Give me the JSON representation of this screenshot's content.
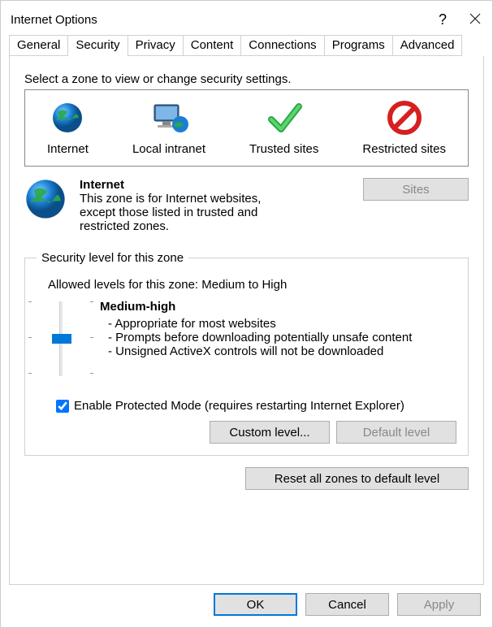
{
  "title": "Internet Options",
  "tabs": [
    "General",
    "Security",
    "Privacy",
    "Content",
    "Connections",
    "Programs",
    "Advanced"
  ],
  "zone_prompt": "Select a zone to view or change security settings.",
  "zones": [
    "Internet",
    "Local intranet",
    "Trusted sites",
    "Restricted sites"
  ],
  "zone_detail": {
    "title": "Internet",
    "desc": "This zone is for Internet websites, except those listed in trusted and restricted zones."
  },
  "sites_button": "Sites",
  "security_legend": "Security level for this zone",
  "allowed_levels": "Allowed levels for this zone: Medium to High",
  "level": {
    "name": "Medium-high",
    "b1": "- Appropriate for most websites",
    "b2": "- Prompts before downloading potentially unsafe content",
    "b3": "- Unsigned ActiveX controls will not be downloaded"
  },
  "protected_mode": "Enable Protected Mode (requires restarting Internet Explorer)",
  "custom_level": "Custom level...",
  "default_level": "Default level",
  "reset_all": "Reset all zones to default level",
  "ok": "OK",
  "cancel": "Cancel",
  "apply": "Apply"
}
